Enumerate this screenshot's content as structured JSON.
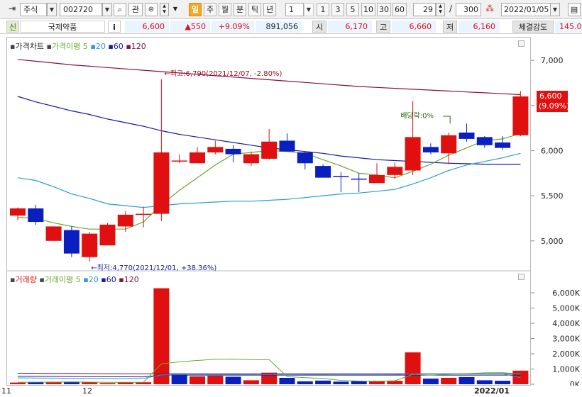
{
  "toolbar": {
    "market_select": "주식",
    "code_input": "002720",
    "btn_gwan": "관",
    "periods": [
      "일",
      "주",
      "월",
      "분",
      "틱",
      "년"
    ],
    "active_period": "일",
    "interval_select": "1",
    "quick_intervals": [
      "1",
      "3",
      "5",
      "10",
      "30",
      "60"
    ],
    "count_input": "29",
    "slash": "/",
    "total_input": "300",
    "date_input": "2022/01/05"
  },
  "quote": {
    "market_badge": "신",
    "name": "국제약품",
    "info_btn": "i",
    "price": "6,600",
    "change": "▲550",
    "change_pct": "+9.09%",
    "volume": "891,056",
    "open_label": "시",
    "open": "6,170",
    "high_label": "고",
    "high": "6,660",
    "low_label": "저",
    "low": "6,160",
    "strength_label": "체결강도",
    "strength": "145.0"
  },
  "price_legend": {
    "title": "가격차트",
    "ma_label": "가격이평",
    "ma5": "5",
    "ma20": "20",
    "ma60": "60",
    "ma120": "120"
  },
  "volume_legend": {
    "title": "거래량",
    "ma_label": "거래이평",
    "ma5": "5",
    "ma20": "20",
    "ma60": "60",
    "ma120": "120"
  },
  "annotations": {
    "high": "최고:6,790(2021/12/07, -2.80%)",
    "low": "최저:4,770(2021/12/01, +38.36%)",
    "dividend": "배당락:0%",
    "last_price": "6,600",
    "last_pct": "(9.09%)"
  },
  "x_labels": [
    "11",
    "12",
    "2022/01"
  ],
  "colors": {
    "up": "#e01010",
    "down": "#0a1fc0",
    "ma5": "#6aa832",
    "ma20": "#2a9bd6",
    "ma60": "#1a1a9a",
    "ma120": "#8a1040",
    "active_period": "#f5a623"
  },
  "chart_data": [
    {
      "type": "candlestick",
      "title": "가격차트",
      "y_ticks": [
        "7,000",
        "6,500",
        "6,000",
        "5,500",
        "5,000"
      ],
      "ylim": [
        4700,
        7150
      ],
      "candles": [
        {
          "o": 5280,
          "h": 5370,
          "l": 5230,
          "c": 5360
        },
        {
          "o": 5360,
          "h": 5400,
          "l": 5180,
          "c": 5210
        },
        {
          "o": 5000,
          "h": 5160,
          "l": 5000,
          "c": 5160
        },
        {
          "o": 5120,
          "h": 5160,
          "l": 4820,
          "c": 4860
        },
        {
          "o": 4820,
          "h": 5100,
          "l": 4770,
          "c": 5080
        },
        {
          "o": 4950,
          "h": 5200,
          "l": 4950,
          "c": 5180
        },
        {
          "o": 5160,
          "h": 5330,
          "l": 5100,
          "c": 5290
        },
        {
          "o": 5300,
          "h": 5380,
          "l": 5150,
          "c": 5300
        },
        {
          "o": 5300,
          "h": 6790,
          "l": 5220,
          "c": 5980
        },
        {
          "o": 5880,
          "h": 5960,
          "l": 5860,
          "c": 5890
        },
        {
          "o": 5860,
          "h": 6040,
          "l": 5860,
          "c": 5980
        },
        {
          "o": 5980,
          "h": 6110,
          "l": 5960,
          "c": 6040
        },
        {
          "o": 6020,
          "h": 6060,
          "l": 5870,
          "c": 5960
        },
        {
          "o": 5860,
          "h": 5990,
          "l": 5830,
          "c": 5960
        },
        {
          "o": 5910,
          "h": 6240,
          "l": 5900,
          "c": 6100
        },
        {
          "o": 6110,
          "h": 6190,
          "l": 5990,
          "c": 5990
        },
        {
          "o": 5980,
          "h": 5990,
          "l": 5790,
          "c": 5860
        },
        {
          "o": 5830,
          "h": 5850,
          "l": 5710,
          "c": 5700
        },
        {
          "o": 5720,
          "h": 5760,
          "l": 5540,
          "c": 5710
        },
        {
          "o": 5690,
          "h": 5750,
          "l": 5540,
          "c": 5680
        },
        {
          "o": 5640,
          "h": 5860,
          "l": 5650,
          "c": 5730
        },
        {
          "o": 5730,
          "h": 5870,
          "l": 5690,
          "c": 5820
        },
        {
          "o": 5780,
          "h": 6550,
          "l": 5730,
          "c": 6150
        },
        {
          "o": 6040,
          "h": 6080,
          "l": 5960,
          "c": 5980
        },
        {
          "o": 5970,
          "h": 6200,
          "l": 5850,
          "c": 6170
        },
        {
          "o": 6200,
          "h": 6300,
          "l": 6100,
          "c": 6130
        },
        {
          "o": 6150,
          "h": 6160,
          "l": 6030,
          "c": 6060
        },
        {
          "o": 6090,
          "h": 6160,
          "l": 6010,
          "c": 6030
        },
        {
          "o": 6170,
          "h": 6660,
          "l": 6160,
          "c": 6600
        }
      ],
      "ma5": [
        5260,
        5250,
        5200,
        5160,
        5130,
        5130,
        5130,
        5210,
        5400,
        5560,
        5700,
        5840,
        5960,
        5980,
        6000,
        5990,
        5970,
        5900,
        5830,
        5750,
        5730,
        5700,
        5770,
        5850,
        5950,
        6030,
        6110,
        6130,
        6190
      ],
      "ma20": [
        5700,
        5670,
        5600,
        5520,
        5470,
        5410,
        5390,
        5370,
        5390,
        5410,
        5420,
        5430,
        5440,
        5440,
        5450,
        5460,
        5480,
        5500,
        5520,
        5530,
        5550,
        5570,
        5630,
        5700,
        5780,
        5840,
        5880,
        5920,
        5970
      ],
      "ma60": [
        6600,
        6540,
        6490,
        6440,
        6400,
        6350,
        6310,
        6270,
        6220,
        6180,
        6150,
        6120,
        6090,
        6060,
        6030,
        6010,
        5990,
        5970,
        5940,
        5920,
        5900,
        5890,
        5880,
        5870,
        5860,
        5855,
        5850,
        5850,
        5850
      ],
      "ma120": [
        7010,
        6990,
        6970,
        6950,
        6935,
        6920,
        6905,
        6890,
        6875,
        6860,
        6845,
        6830,
        6815,
        6800,
        6785,
        6770,
        6755,
        6740,
        6725,
        6710,
        6700,
        6690,
        6680,
        6670,
        6660,
        6650,
        6640,
        6630,
        6620
      ]
    },
    {
      "type": "bar",
      "title": "거래량",
      "y_ticks": [
        "6,000K",
        "5,000K",
        "4,000K",
        "3,000K",
        "2,000K",
        "1,000K",
        "0K"
      ],
      "ylim": [
        0,
        6700
      ],
      "values": [
        110,
        130,
        150,
        170,
        140,
        80,
        120,
        130,
        6300,
        680,
        520,
        560,
        490,
        260,
        760,
        420,
        190,
        240,
        170,
        210,
        190,
        230,
        2090,
        370,
        420,
        470,
        260,
        230,
        891
      ],
      "up": [
        true,
        false,
        true,
        false,
        true,
        true,
        true,
        true,
        true,
        false,
        true,
        true,
        false,
        true,
        true,
        false,
        false,
        false,
        false,
        false,
        true,
        true,
        true,
        false,
        true,
        false,
        false,
        false,
        true
      ],
      "ma5": [
        130,
        140,
        140,
        150,
        140,
        130,
        130,
        130,
        1340,
        1470,
        1560,
        1640,
        1650,
        1610,
        1610,
        500,
        430,
        380,
        250,
        210,
        200,
        230,
        650,
        600,
        660,
        700,
        750,
        760,
        680
      ],
      "ma20": [
        420,
        410,
        400,
        390,
        380,
        380,
        370,
        380,
        610,
        630,
        640,
        640,
        650,
        640,
        640,
        630,
        640,
        640,
        630,
        630,
        630,
        640,
        680,
        680,
        690,
        690,
        700,
        700,
        430
      ],
      "ma60": [
        520,
        515,
        510,
        505,
        500,
        495,
        490,
        485,
        600,
        600,
        600,
        600,
        600,
        600,
        600,
        600,
        600,
        600,
        600,
        600,
        600,
        600,
        600,
        600,
        600,
        600,
        600,
        600,
        600
      ],
      "ma120": [
        720,
        715,
        710,
        705,
        700,
        695,
        690,
        685,
        690,
        690,
        690,
        690,
        690,
        690,
        690,
        690,
        690,
        690,
        690,
        690,
        690,
        690,
        690,
        690,
        690,
        690,
        690,
        690,
        690
      ]
    }
  ]
}
